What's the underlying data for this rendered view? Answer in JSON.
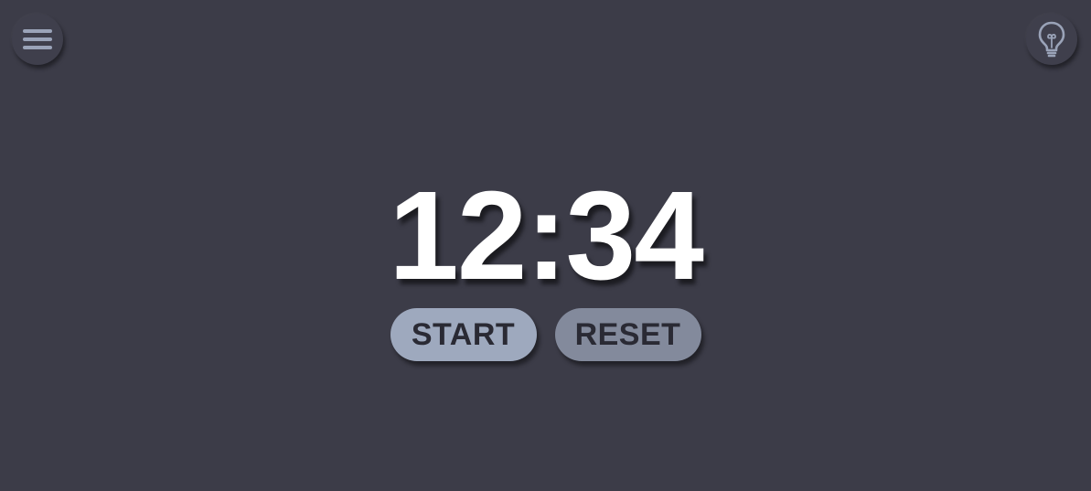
{
  "icons": {
    "menu": "hamburger-menu-icon",
    "idea": "lightbulb-icon"
  },
  "timer": {
    "display": "12:34"
  },
  "controls": {
    "start_label": "START",
    "reset_label": "RESET"
  },
  "colors": {
    "background": "#3c3c48",
    "start_button": "#9ea9be",
    "reset_button": "#838a9c",
    "icon": "#9aa3b8",
    "time_text": "#ffffff"
  }
}
